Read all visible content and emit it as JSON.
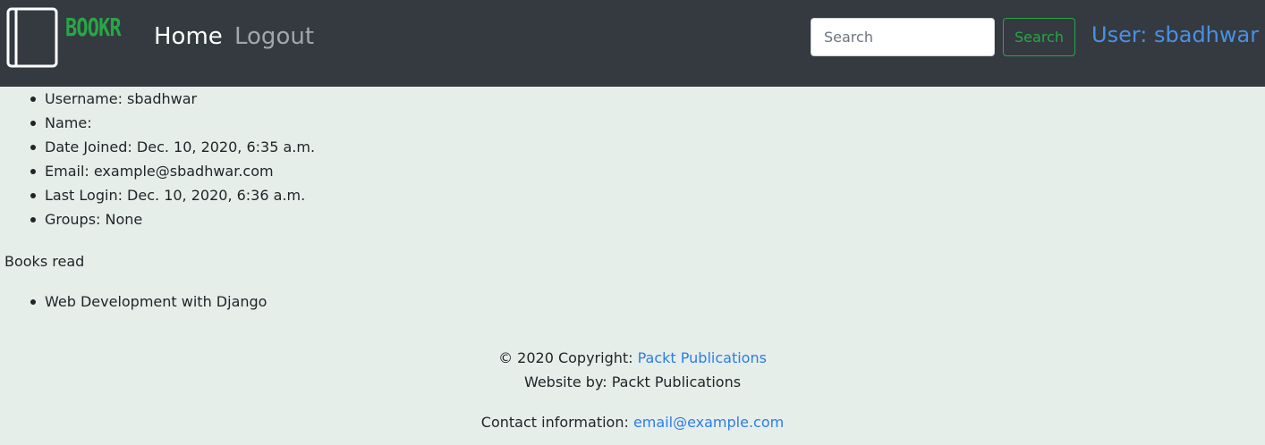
{
  "navbar": {
    "brand": "BOOKR",
    "logo_icon": "book-icon",
    "links": {
      "home": "Home",
      "logout": "Logout"
    },
    "search": {
      "placeholder": "Search",
      "value": "",
      "button_label": "Search"
    },
    "user_label": "User: sbadhwar"
  },
  "profile": {
    "fields": [
      "Username: sbadhwar",
      "Name:",
      "Date Joined: Dec. 10, 2020, 6:35 a.m.",
      "Email: example@sbadhwar.com",
      "Last Login: Dec. 10, 2020, 6:36 a.m.",
      "Groups: None"
    ],
    "books_heading": "Books read",
    "books": [
      "Web Development with Django"
    ]
  },
  "footer": {
    "copyright_prefix": "© 2020 Copyright:",
    "copyright_link": "Packt Publications",
    "website_by": "Website by: Packt Publications",
    "contact_prefix": "Contact information:",
    "contact_email": "email@example.com"
  },
  "colors": {
    "navbar_bg": "#343a40",
    "page_bg": "#e6eeea",
    "brand_green": "#28a745",
    "link_blue": "#2b7de9"
  }
}
